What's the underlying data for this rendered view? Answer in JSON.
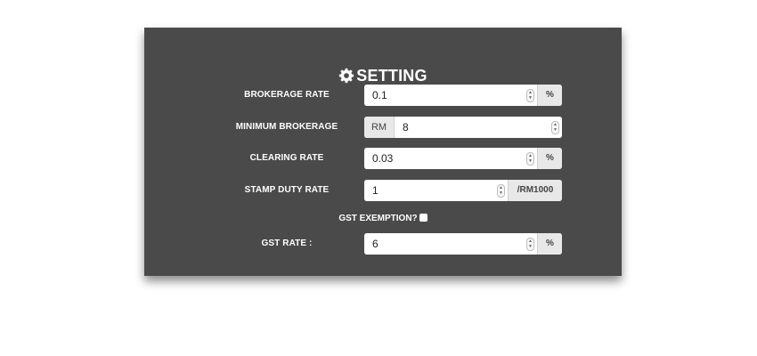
{
  "title": "SETTING",
  "fields": {
    "brokerage_rate": {
      "label": "BROKERAGE RATE",
      "value": "0.1",
      "suffix": "%"
    },
    "minimum_brokerage": {
      "label": "MINIMUM BROKERAGE",
      "prefix": "RM",
      "value": "8"
    },
    "clearing_rate": {
      "label": "CLEARING RATE",
      "value": "0.03",
      "suffix": "%"
    },
    "stamp_duty_rate": {
      "label": "STAMP DUTY RATE",
      "value": "1",
      "suffix": "/RM1000"
    },
    "gst_exemption": {
      "label": "GST EXEMPTION?",
      "checked": false
    },
    "gst_rate": {
      "label": "GST RATE :",
      "value": "6",
      "suffix": "%"
    }
  },
  "icons": {
    "title_icon": "gear-icon",
    "spinner": "spinner-icon"
  },
  "colors": {
    "panel_bg": "#4a4a4a",
    "text": "#ffffff",
    "addon_bg": "#e8e8e8"
  }
}
